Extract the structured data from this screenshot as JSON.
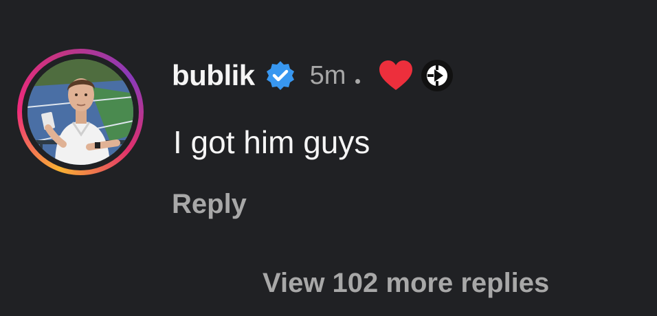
{
  "comment": {
    "username": "bublik",
    "timestamp": "5m",
    "text": "I got him guys",
    "reply_label": "Reply",
    "view_more_label": "View 102 more replies",
    "icons": {
      "verified": "verified-badge-icon",
      "liked": "heart-icon",
      "creator": "creator-logo-icon",
      "avatar": "profile-avatar"
    },
    "colors": {
      "background": "#202124",
      "verified_blue": "#3897f0",
      "heart_red": "#ed2f3c",
      "secondary_text": "#a8a8a8"
    }
  }
}
